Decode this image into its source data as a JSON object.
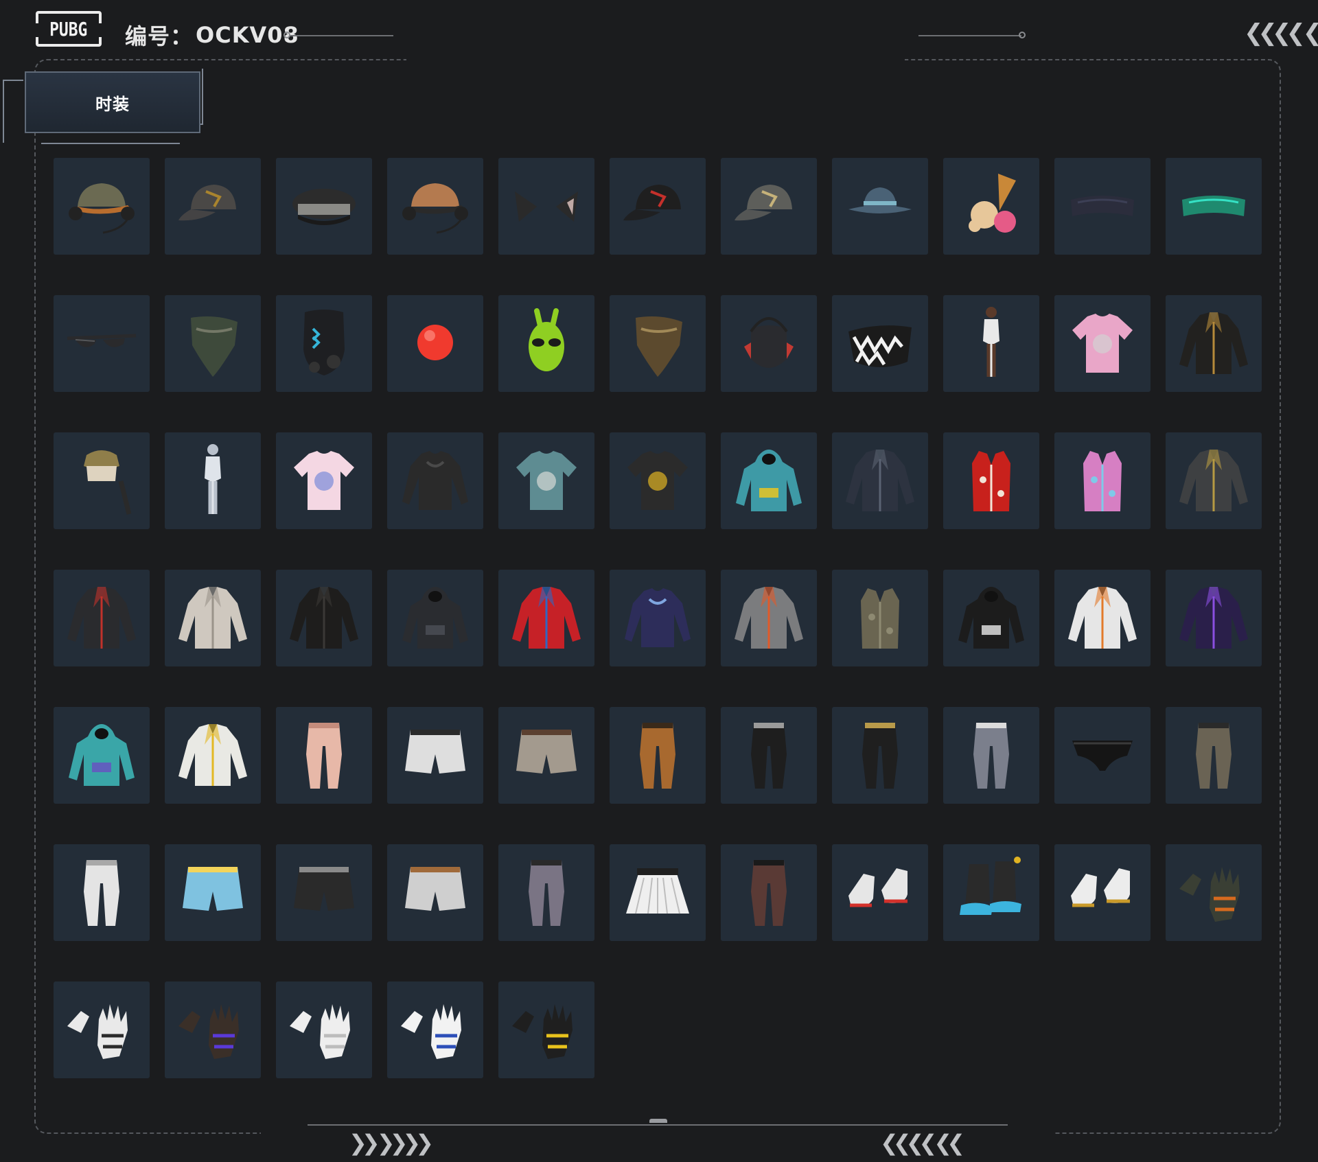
{
  "header": {
    "logo_text": "PUBG",
    "serial_label": "编号：",
    "serial_code": "OCKV08"
  },
  "tab": {
    "label": "时装"
  },
  "decor": {
    "top_right_chevrons": "❮❮❮❮ ❮",
    "bottom_left_chevrons": "❯❯ ❯❯❯❯",
    "bottom_right_chevrons": "❮❮❮❮ ❮❮"
  },
  "colors": {
    "background": "#1b1c1e",
    "tile": "#232d38",
    "frame_dash": "#55585d",
    "tab_fill": "#2a3442"
  },
  "items": [
    {
      "name": "headset-cap-olive-icon",
      "icon": "headset-cap",
      "color": "#6b6a52",
      "accent": "#b86d2e"
    },
    {
      "name": "cap-grey-camo-icon",
      "icon": "cap",
      "color": "#4a4846",
      "accent": "#a9842e"
    },
    {
      "name": "officer-hat-black-icon",
      "icon": "officer-hat",
      "color": "#2c2c2c",
      "accent": "#8a8a86"
    },
    {
      "name": "headset-cap-tan-icon",
      "icon": "headset-cap",
      "color": "#b47a4f",
      "accent": "#2a2a2a"
    },
    {
      "name": "cat-ears-icon",
      "icon": "cat-ears",
      "color": "#2a2a2a",
      "accent": "#c0a9a5"
    },
    {
      "name": "cap-black-icon",
      "icon": "cap",
      "color": "#1f1f1f",
      "accent": "#c4302b"
    },
    {
      "name": "cap-stone-icon",
      "icon": "cap",
      "color": "#5d5e5a",
      "accent": "#c6b27a"
    },
    {
      "name": "bucket-hat-icon",
      "icon": "bucket-hat",
      "color": "#4a6276",
      "accent": "#7fb6c7"
    },
    {
      "name": "ice-cream-hat-icon",
      "icon": "ice-cream",
      "color": "#e7c79a",
      "accent": "#e55b87"
    },
    {
      "name": "visor-dark-icon",
      "icon": "visor",
      "color": "#2b2d3c",
      "accent": "#3c3f55"
    },
    {
      "name": "visor-neon-icon",
      "icon": "visor",
      "color": "#1f8a6f",
      "accent": "#35e1c4"
    },
    {
      "name": "sunglasses-icon",
      "icon": "glasses",
      "color": "#2a2a2c",
      "accent": "#55575a"
    },
    {
      "name": "camo-bandana-icon",
      "icon": "bandana",
      "color": "#3e4a3b",
      "accent": "#8c8c7a"
    },
    {
      "name": "cyber-mask-icon",
      "icon": "cyber-mask",
      "color": "#1e1f22",
      "accent": "#35b5d9"
    },
    {
      "name": "clown-nose-icon",
      "icon": "ball",
      "color": "#f03a2e",
      "accent": "#ff9a8e"
    },
    {
      "name": "alien-mask-icon",
      "icon": "alien",
      "color": "#8fcf22",
      "accent": "#1b1b1b"
    },
    {
      "name": "leopard-bandana-icon",
      "icon": "bandana",
      "color": "#5c4a2e",
      "accent": "#bfa46a"
    },
    {
      "name": "tactical-mask-icon",
      "icon": "tactical-mask",
      "color": "#2a2b2f",
      "accent": "#c23a33"
    },
    {
      "name": "teeth-face-mask-icon",
      "icon": "teeth-mask",
      "color": "#1b1b1b",
      "accent": "#f2f2f2"
    },
    {
      "name": "swimsuit-figure-icon",
      "icon": "figure",
      "color": "#e9e9e9",
      "accent": "#5a3a2a"
    },
    {
      "name": "pink-tshirt-icon",
      "icon": "tshirt",
      "color": "#e9a6c8",
      "accent": "#d2d2d2"
    },
    {
      "name": "black-blazer-icon",
      "icon": "jacket",
      "color": "#22211f",
      "accent": "#b58a3a"
    },
    {
      "name": "crop-top-icon",
      "icon": "crop-top",
      "color": "#ded3bf",
      "accent": "#8f7e4a"
    },
    {
      "name": "white-bodysuit-icon",
      "icon": "figure",
      "color": "#dfe4ea",
      "accent": "#b9c1cc"
    },
    {
      "name": "galaxy-tshirt-icon",
      "icon": "tshirt",
      "color": "#f4d7e3",
      "accent": "#7a8bd8"
    },
    {
      "name": "lace-blouse-icon",
      "icon": "longsleeve",
      "color": "#2a2a2a",
      "accent": "#4a4a4a"
    },
    {
      "name": "floral-shirt-icon",
      "icon": "tshirt",
      "color": "#5e8c92",
      "accent": "#d6d9d6"
    },
    {
      "name": "graphic-tee-icon",
      "icon": "tshirt",
      "color": "#2b2b2b",
      "accent": "#e0b324"
    },
    {
      "name": "duck-hoodie-icon",
      "icon": "hoodie",
      "color": "#3e9aa6",
      "accent": "#f2c81a"
    },
    {
      "name": "navy-jacket-icon",
      "icon": "jacket",
      "color": "#2d3340",
      "accent": "#5a6272"
    },
    {
      "name": "red-floral-vest-icon",
      "icon": "vest",
      "color": "#c8211c",
      "accent": "#f1e4d7"
    },
    {
      "name": "holo-puffer-vest-icon",
      "icon": "vest",
      "color": "#d67fc3",
      "accent": "#7fc9e8"
    },
    {
      "name": "grey-suit-icon",
      "icon": "jacket",
      "color": "#3e4042",
      "accent": "#b59a43"
    },
    {
      "name": "biker-jacket-icon",
      "icon": "jacket",
      "color": "#2a2b2e",
      "accent": "#c1322b"
    },
    {
      "name": "silver-jacket-icon",
      "icon": "jacket",
      "color": "#cfc8bf",
      "accent": "#9a938a"
    },
    {
      "name": "leather-jacket-icon",
      "icon": "jacket",
      "color": "#1e1d1c",
      "accent": "#3a3836"
    },
    {
      "name": "hooded-jacket-icon",
      "icon": "hoodie",
      "color": "#2a2c30",
      "accent": "#4c5058"
    },
    {
      "name": "race-jacket-icon",
      "icon": "jacket",
      "color": "#c62127",
      "accent": "#2f67c2"
    },
    {
      "name": "varsity-sweater-icon",
      "icon": "longsleeve",
      "color": "#2d2d5a",
      "accent": "#7fa6e0"
    },
    {
      "name": "grey-orange-jacket-icon",
      "icon": "jacket",
      "color": "#7b7c7e",
      "accent": "#e15a2a"
    },
    {
      "name": "utility-vest-icon",
      "icon": "vest",
      "color": "#6a6551",
      "accent": "#8e8a72"
    },
    {
      "name": "black-hoodie-icon",
      "icon": "hoodie",
      "color": "#1c1c1c",
      "accent": "#e9e9e9"
    },
    {
      "name": "astro-jacket-icon",
      "icon": "jacket",
      "color": "#e6e6e6",
      "accent": "#e27a2b"
    },
    {
      "name": "purple-jacket-icon",
      "icon": "jacket",
      "color": "#2a1f4a",
      "accent": "#8a4fe0"
    },
    {
      "name": "gradient-hoodie-icon",
      "icon": "hoodie",
      "color": "#3aa6a8",
      "accent": "#6a4fc2"
    },
    {
      "name": "yellow-crop-jacket-icon",
      "icon": "jacket",
      "color": "#e9e9e4",
      "accent": "#e3b822"
    },
    {
      "name": "pink-joggers-icon",
      "icon": "pants",
      "color": "#e7b8a8",
      "accent": "#c48c7c"
    },
    {
      "name": "white-shorts-icon",
      "icon": "shorts",
      "color": "#dedede",
      "accent": "#2a2a2a"
    },
    {
      "name": "plaid-shorts-icon",
      "icon": "shorts",
      "color": "#a39a8e",
      "accent": "#5b4030"
    },
    {
      "name": "tan-pants-icon",
      "icon": "pants",
      "color": "#a8692f",
      "accent": "#3a2a1a"
    },
    {
      "name": "black-chain-pants-icon",
      "icon": "pants",
      "color": "#1e1e1e",
      "accent": "#9a9a9a"
    },
    {
      "name": "black-gold-pants-icon",
      "icon": "pants",
      "color": "#1f1f1f",
      "accent": "#b89a4a"
    },
    {
      "name": "sure-print-pants-icon",
      "icon": "pants",
      "color": "#7b7f8c",
      "accent": "#dcdcdc"
    },
    {
      "name": "black-briefs-icon",
      "icon": "briefs",
      "color": "#151515",
      "accent": "#3a3a3a"
    },
    {
      "name": "cargo-pants-icon",
      "icon": "pants",
      "color": "#6a6354",
      "accent": "#2a2a2a"
    },
    {
      "name": "white-cargo-pants-icon",
      "icon": "pants",
      "color": "#e4e4e4",
      "accent": "#a8a8a8"
    },
    {
      "name": "blue-frill-shorts-icon",
      "icon": "shorts",
      "color": "#7fc2e0",
      "accent": "#f3d45a"
    },
    {
      "name": "black-belt-shorts-icon",
      "icon": "shorts",
      "color": "#2a2a2a",
      "accent": "#8a8a8a"
    },
    {
      "name": "white-belt-shorts-icon",
      "icon": "shorts",
      "color": "#cfcfcf",
      "accent": "#a06a3a"
    },
    {
      "name": "camo-pants-icon",
      "icon": "pants",
      "color": "#7a7484",
      "accent": "#2a2a2a"
    },
    {
      "name": "pleated-skirt-icon",
      "icon": "skirt",
      "color": "#efefef",
      "accent": "#1f1f1f"
    },
    {
      "name": "leggings-boots-icon",
      "icon": "pants",
      "color": "#5a3a35",
      "accent": "#1a1a1a"
    },
    {
      "name": "red-sneakers-icon",
      "icon": "shoes",
      "color": "#e6e6e6",
      "accent": "#d3312b"
    },
    {
      "name": "blue-boots-icon",
      "icon": "boots",
      "color": "#2a2a2a",
      "accent": "#3cb4de"
    },
    {
      "name": "white-gold-shoes-icon",
      "icon": "shoes",
      "color": "#ececec",
      "accent": "#c99a2a"
    },
    {
      "name": "tactical-gloves-orange-icon",
      "icon": "gloves",
      "color": "#3a3f34",
      "accent": "#d66a1e"
    },
    {
      "name": "white-black-gloves-icon",
      "icon": "gloves",
      "color": "#e9e9e9",
      "accent": "#2a2a2a"
    },
    {
      "name": "purple-claw-gloves-icon",
      "icon": "gloves",
      "color": "#3a2f28",
      "accent": "#5a3ad8"
    },
    {
      "name": "white-gloves-icon",
      "icon": "gloves",
      "color": "#eeeeee",
      "accent": "#bcbcbc"
    },
    {
      "name": "blue-white-gloves-icon",
      "icon": "gloves",
      "color": "#f2f2f2",
      "accent": "#2d4fb8"
    },
    {
      "name": "black-yellow-gloves-icon",
      "icon": "gloves",
      "color": "#1f1f1f",
      "accent": "#e8c21c"
    }
  ]
}
